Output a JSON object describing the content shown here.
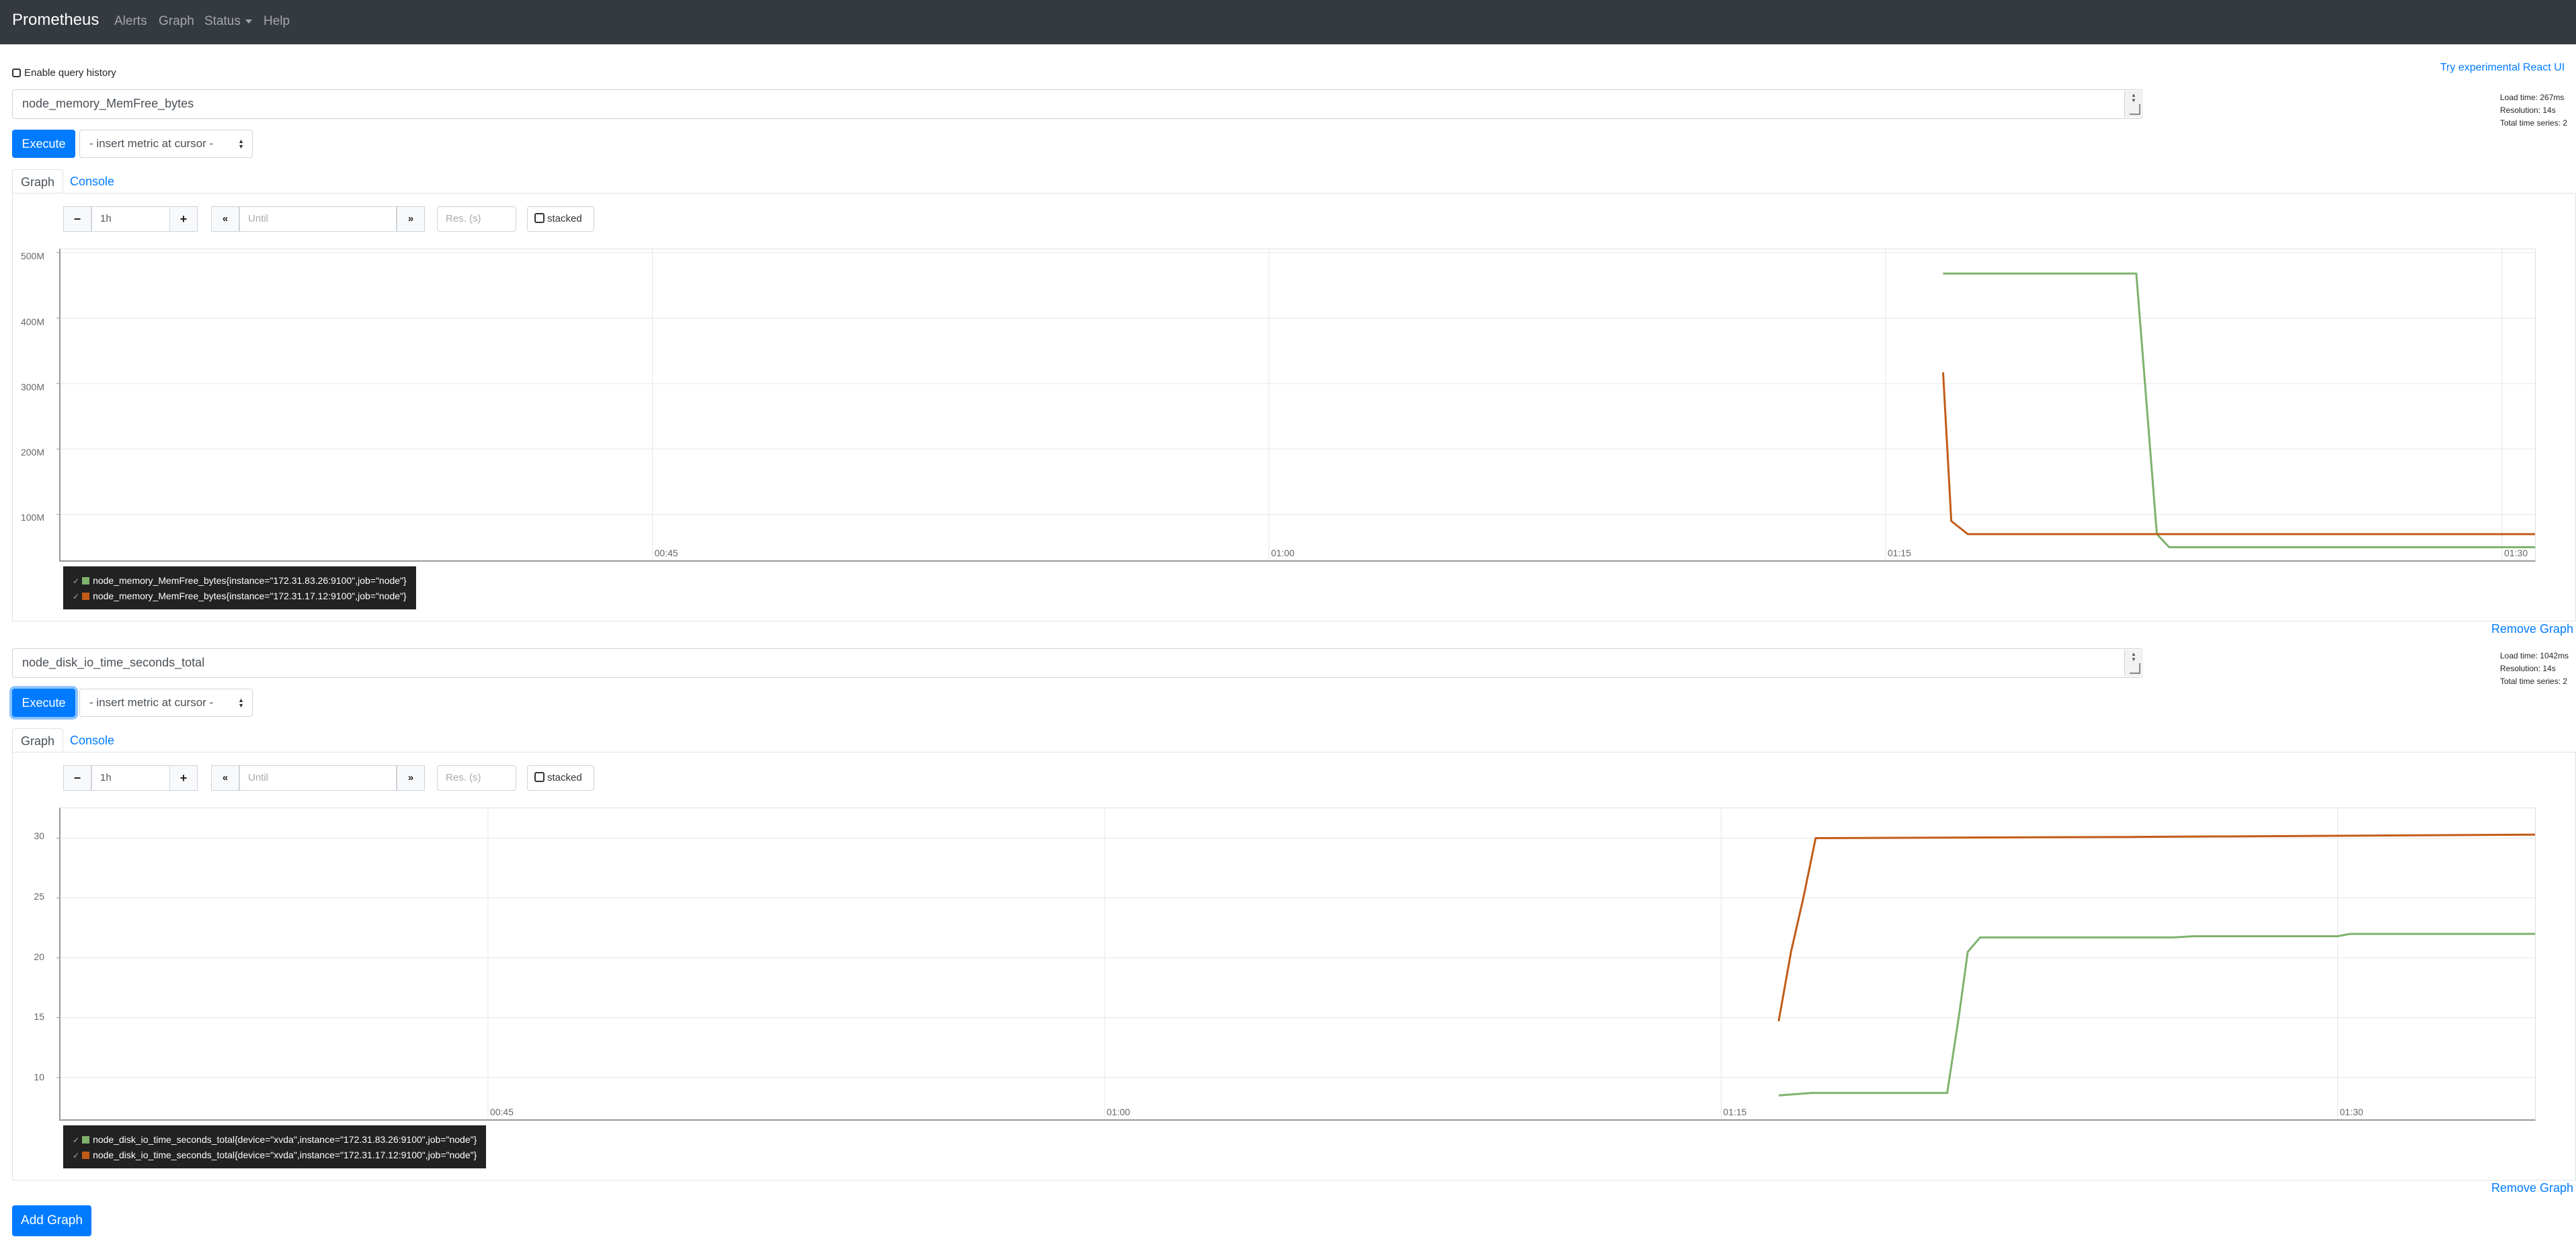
{
  "navbar": {
    "brand": "Prometheus",
    "links": [
      "Alerts",
      "Graph",
      "Status",
      "Help"
    ]
  },
  "query_history_label": "Enable query history",
  "experimental_link": "Try experimental React UI",
  "graphs": [
    {
      "expression": "node_memory_MemFree_bytes",
      "stats": {
        "load_time": "Load time: 267ms",
        "resolution": "Resolution: 14s",
        "total_series": "Total time series: 2"
      },
      "execute_label": "Execute",
      "insert_metric_label": "- insert metric at cursor -",
      "tabs": [
        "Graph",
        "Console"
      ],
      "range_value": "1h",
      "until_placeholder": "Until",
      "res_placeholder": "Res. (s)",
      "stacked_label": "stacked",
      "remove_label": "Remove Graph",
      "legend": [
        {
          "label": "node_memory_MemFree_bytes{instance=\"172.31.83.26:9100\",job=\"node\"}",
          "color": "#7eb26d"
        },
        {
          "label": "node_memory_MemFree_bytes{instance=\"172.31.17.12:9100\",job=\"node\"}",
          "color": "#c15c17"
        }
      ]
    },
    {
      "expression": "node_disk_io_time_seconds_total",
      "stats": {
        "load_time": "Load time: 1042ms",
        "resolution": "Resolution: 14s",
        "total_series": "Total time series: 2"
      },
      "execute_label": "Execute",
      "insert_metric_label": "- insert metric at cursor -",
      "tabs": [
        "Graph",
        "Console"
      ],
      "range_value": "1h",
      "until_placeholder": "Until",
      "res_placeholder": "Res. (s)",
      "stacked_label": "stacked",
      "remove_label": "Remove Graph",
      "legend": [
        {
          "label": "node_disk_io_time_seconds_total{device=\"xvda\",instance=\"172.31.83.26:9100\",job=\"node\"}",
          "color": "#7eb26d"
        },
        {
          "label": "node_disk_io_time_seconds_total{device=\"xvda\",instance=\"172.31.17.12:9100\",job=\"node\"}",
          "color": "#c15c17"
        }
      ]
    }
  ],
  "add_graph_label": "Add Graph",
  "chart_data": [
    {
      "type": "line",
      "x_ticks": [
        "00:45",
        "01:00",
        "01:15",
        "01:30"
      ],
      "x_tick_minutes": [
        45,
        60,
        75,
        90
      ],
      "xlim_minutes": [
        30.6,
        90.8
      ],
      "y_ticks": [
        "100M",
        "200M",
        "300M",
        "400M",
        "500M"
      ],
      "y_tick_values": [
        100,
        200,
        300,
        400,
        500
      ],
      "ylim": [
        30,
        505
      ],
      "y_unit": "M",
      "grid": true,
      "series": [
        {
          "name": "node_memory_MemFree_bytes{instance=\"172.31.83.26:9100\",job=\"node\"}",
          "color": "#7eb26d",
          "x": [
            76.4,
            81.1,
            81.6,
            81.9,
            90.8
          ],
          "y": [
            468,
            468,
            70,
            50,
            50
          ]
        },
        {
          "name": "node_memory_MemFree_bytes{instance=\"172.31.17.12:9100\",job=\"node\"}",
          "color": "#c15c17",
          "x": [
            76.4,
            76.6,
            77.0,
            90.8
          ],
          "y": [
            317,
            90,
            70,
            70
          ]
        }
      ]
    },
    {
      "type": "line",
      "x_ticks": [
        "00:45",
        "01:00",
        "01:15",
        "01:30"
      ],
      "x_tick_minutes": [
        45,
        60,
        75,
        90
      ],
      "xlim_minutes": [
        34.6,
        94.8
      ],
      "y_ticks": [
        "10",
        "15",
        "20",
        "25",
        "30"
      ],
      "y_tick_values": [
        10,
        15,
        20,
        25,
        30
      ],
      "ylim": [
        6.5,
        32.5
      ],
      "grid": true,
      "series": [
        {
          "name": "node_disk_io_time_seconds_total{device=\"xvda\",instance=\"172.31.83.26:9100\",job=\"node\"}",
          "color": "#7eb26d",
          "x": [
            76.4,
            77.2,
            80.5,
            80.8,
            81.0,
            81.3,
            86.0,
            86.5,
            90.0,
            90.3,
            94.8
          ],
          "y": [
            8.5,
            8.7,
            8.7,
            15.5,
            20.5,
            21.7,
            21.7,
            21.8,
            21.8,
            22.0,
            22.0
          ],
          "note": ""
        },
        {
          "name": "node_disk_io_time_seconds_total{device=\"xvda\",instance=\"172.31.17.12:9100\",job=\"node\"}",
          "color": "#c15c17",
          "x": [
            76.4,
            76.7,
            77.0,
            77.3,
            85.0,
            94.8
          ],
          "y": [
            14.7,
            20.5,
            25.0,
            30.0,
            30.1,
            30.3
          ]
        }
      ]
    }
  ]
}
